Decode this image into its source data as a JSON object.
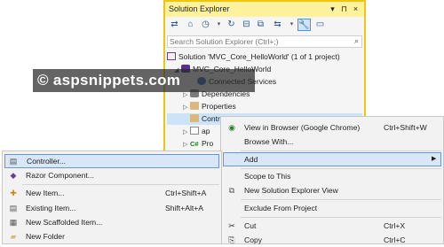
{
  "solution_explorer": {
    "title": "Solution Explorer",
    "search_placeholder": "Search Solution Explorer (Ctrl+;)",
    "tree": {
      "solution": "Solution 'MVC_Core_HelloWorld' (1 of 1 project)",
      "project": "MVC_Core_HelloWorld",
      "connected_services": "Connected Services",
      "dependencies": "Dependencies",
      "properties": "Properties",
      "controllers": "Controllers",
      "item_ap": "ap",
      "item_pro": "Pro"
    }
  },
  "watermark": "© aspsnippets.com",
  "context_menu": {
    "items": [
      {
        "label": "View in Browser (Google Chrome)",
        "shortcut": "Ctrl+Shift+W"
      },
      {
        "label": "Browse With...",
        "shortcut": ""
      },
      {
        "label": "Add",
        "shortcut": ""
      },
      {
        "label": "Scope to This",
        "shortcut": ""
      },
      {
        "label": "New Solution Explorer View",
        "shortcut": ""
      },
      {
        "label": "Exclude From Project",
        "shortcut": ""
      },
      {
        "label": "Cut",
        "shortcut": "Ctrl+X"
      },
      {
        "label": "Copy",
        "shortcut": "Ctrl+C"
      }
    ]
  },
  "add_submenu": {
    "items": [
      {
        "label": "Controller...",
        "shortcut": ""
      },
      {
        "label": "Razor Component...",
        "shortcut": ""
      },
      {
        "label": "New Item...",
        "shortcut": "Ctrl+Shift+A"
      },
      {
        "label": "Existing Item...",
        "shortcut": "Shift+Alt+A"
      },
      {
        "label": "New Scaffolded Item...",
        "shortcut": ""
      },
      {
        "label": "New Folder",
        "shortcut": ""
      }
    ]
  },
  "colors": {
    "title_accent": "#fff29d",
    "border_accent": "#f1c40f",
    "highlight": "#d9e6f7",
    "highlight_border": "#6c96d3"
  }
}
